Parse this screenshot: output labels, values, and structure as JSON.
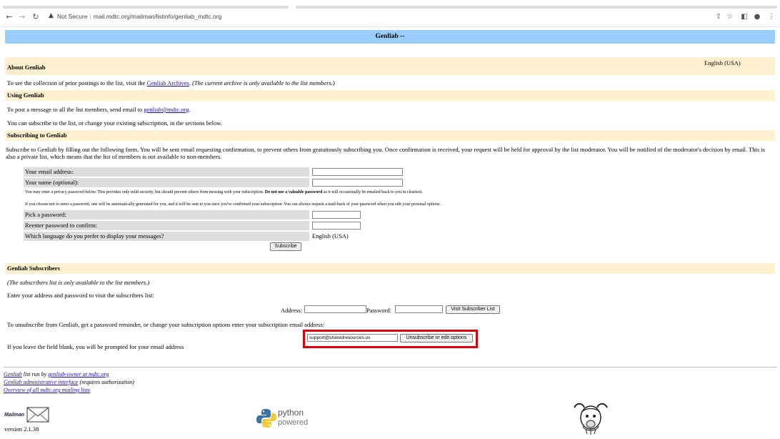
{
  "browser": {
    "url_security": "Not Secure",
    "url": "mail.mdtc.org/mailman/listinfo/genliab_mdtc.org"
  },
  "page": {
    "title": "Genliab --",
    "language": "English (USA)"
  },
  "about": {
    "heading": "About Genliab",
    "text_prefix": "To see the collection of prior postings to the list, visit the ",
    "archives_link": "Genliab Archives",
    "text_mid": ". ",
    "note": "(The current archive is only available to the list members.)"
  },
  "using": {
    "heading": "Using Genliab",
    "post_prefix": "To post a message to all the list members, send email to ",
    "post_email": "genliab@mdtc.org",
    "post_suffix": ".",
    "subscribe_text": "You can subscribe to the list, or change your existing subscription, in the sections below."
  },
  "subscribing": {
    "heading": "Subscribing to Genliab",
    "description": "Subscribe to Genliab by filling out the following form. You will be sent email requesting confirmation, to prevent others from gratuitously subscribing you. Once confirmation is received, your request will be held for approval by the list moderator. You will be notified of the moderator's decision by email. This is also a private list, which means that the list of members is not available to non-members.",
    "email_label": "Your email address:",
    "name_label": "Your name (optional):",
    "privacy_note_prefix": "You may enter a privacy password below. This provides only mild security, but should prevent others from messing with your subscription. ",
    "privacy_note_bold": "Do not use a valuable password",
    "privacy_note_suffix": " as it will occasionally be emailed back to you in cleartext.",
    "password_note": "If you choose not to enter a password, one will be automatically generated for you, and it will be sent to you once you've confirmed your subscription. You can always request a mail-back of your password when you edit your personal options.",
    "pick_password_label": "Pick a password:",
    "reenter_password_label": "Reenter password to confirm:",
    "language_label": "Which language do you prefer to display your messages?",
    "language_value": "English (USA)",
    "subscribe_button": "Subscribe"
  },
  "subscribers": {
    "heading": "Genliab Subscribers",
    "note": "(The subscribers list is only available to the list members.)",
    "enter_text": "Enter your address and password to visit the subscribers list:",
    "address_label": "Address:",
    "password_label": "Password:",
    "visit_button": "Visit Subscriber List",
    "unsubscribe_text": "To unsubscribe from Genliab, get a password reminder, or change your subscription options enter your subscription email address:",
    "email_value": "support@sharedresources.us",
    "unsubscribe_button": "Unsubscribe or edit options",
    "blank_note": "If you leave the field blank, you will be prompted for your email address"
  },
  "footer": {
    "list_link": "Genliab",
    "run_by_text": " list run by ",
    "owner_link": "genliab-owner at mdtc.org",
    "admin_link": "Genliab administrative interface",
    "admin_suffix": " (requires authorization)",
    "overview_link": "Overview of all mdtc.org mailing lists",
    "mailman_logo_text": "Mailman",
    "version": "version 2.1.38",
    "python_line1": "python",
    "python_line2": "powered"
  }
}
